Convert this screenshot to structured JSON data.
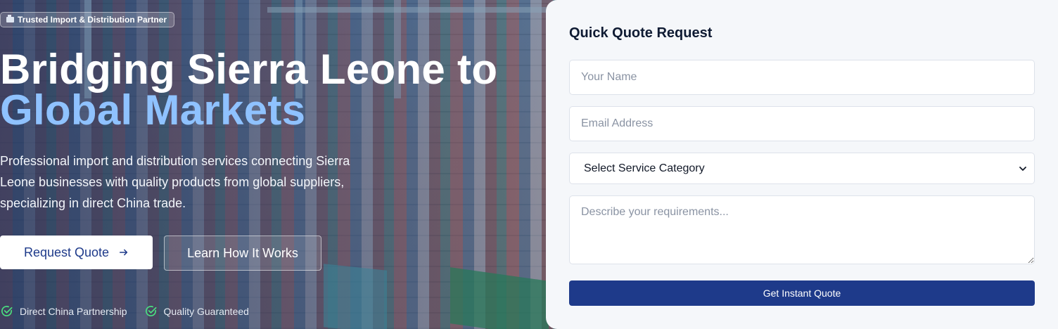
{
  "hero": {
    "badge": "Trusted Import & Distribution Partner",
    "badge_icon": "ship-icon",
    "headline_line1": "Bridging Sierra Leone to",
    "headline_line2": "Global Markets",
    "subtext": "Professional import and distribution services connecting Sierra Leone businesses with quality products from global suppliers, specializing in direct China trade.",
    "primary_button": "Request Quote",
    "secondary_button": "Learn How It Works",
    "features": [
      {
        "label": "Direct China Partnership",
        "icon": "check-circle-icon"
      },
      {
        "label": "Quality Guaranteed",
        "icon": "check-circle-icon"
      }
    ]
  },
  "quote_form": {
    "title": "Quick Quote Request",
    "name_placeholder": "Your Name",
    "email_placeholder": "Email Address",
    "service_select": "Select Service Category",
    "requirements_placeholder": "Describe your requirements...",
    "submit_label": "Get Instant Quote"
  },
  "colors": {
    "primary": "#1e3a8a",
    "headline_accent": "#8fc2ff",
    "check_green": "#4ade80",
    "panel_bg": "#f5f7fa"
  }
}
